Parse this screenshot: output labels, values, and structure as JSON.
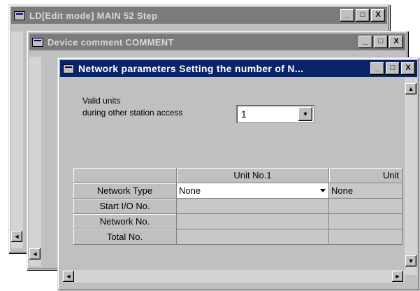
{
  "windows": {
    "back": {
      "title": "LD[Edit mode]    MAIN    52 Step"
    },
    "middle": {
      "title": "Device comment COMMENT"
    },
    "front": {
      "title": "Network parameters  Setting the number of N..."
    }
  },
  "title_buttons": {
    "minimize": "_",
    "maximize": "□",
    "close": "X"
  },
  "valid_units": {
    "label_line1": "Valid units",
    "label_line2": "during other station access",
    "value": "1"
  },
  "grid": {
    "columns": [
      "",
      "Unit No.1",
      "Unit"
    ],
    "rows": [
      {
        "label": "Network Type",
        "unit1": "None",
        "unit2": "None"
      },
      {
        "label": "Start I/O No.",
        "unit1": "",
        "unit2": ""
      },
      {
        "label": "Network No.",
        "unit1": "",
        "unit2": ""
      },
      {
        "label": "Total No.",
        "unit1": "",
        "unit2": ""
      }
    ]
  },
  "icons": {
    "up": "▲",
    "down": "▼",
    "left": "◄",
    "right": "►"
  }
}
